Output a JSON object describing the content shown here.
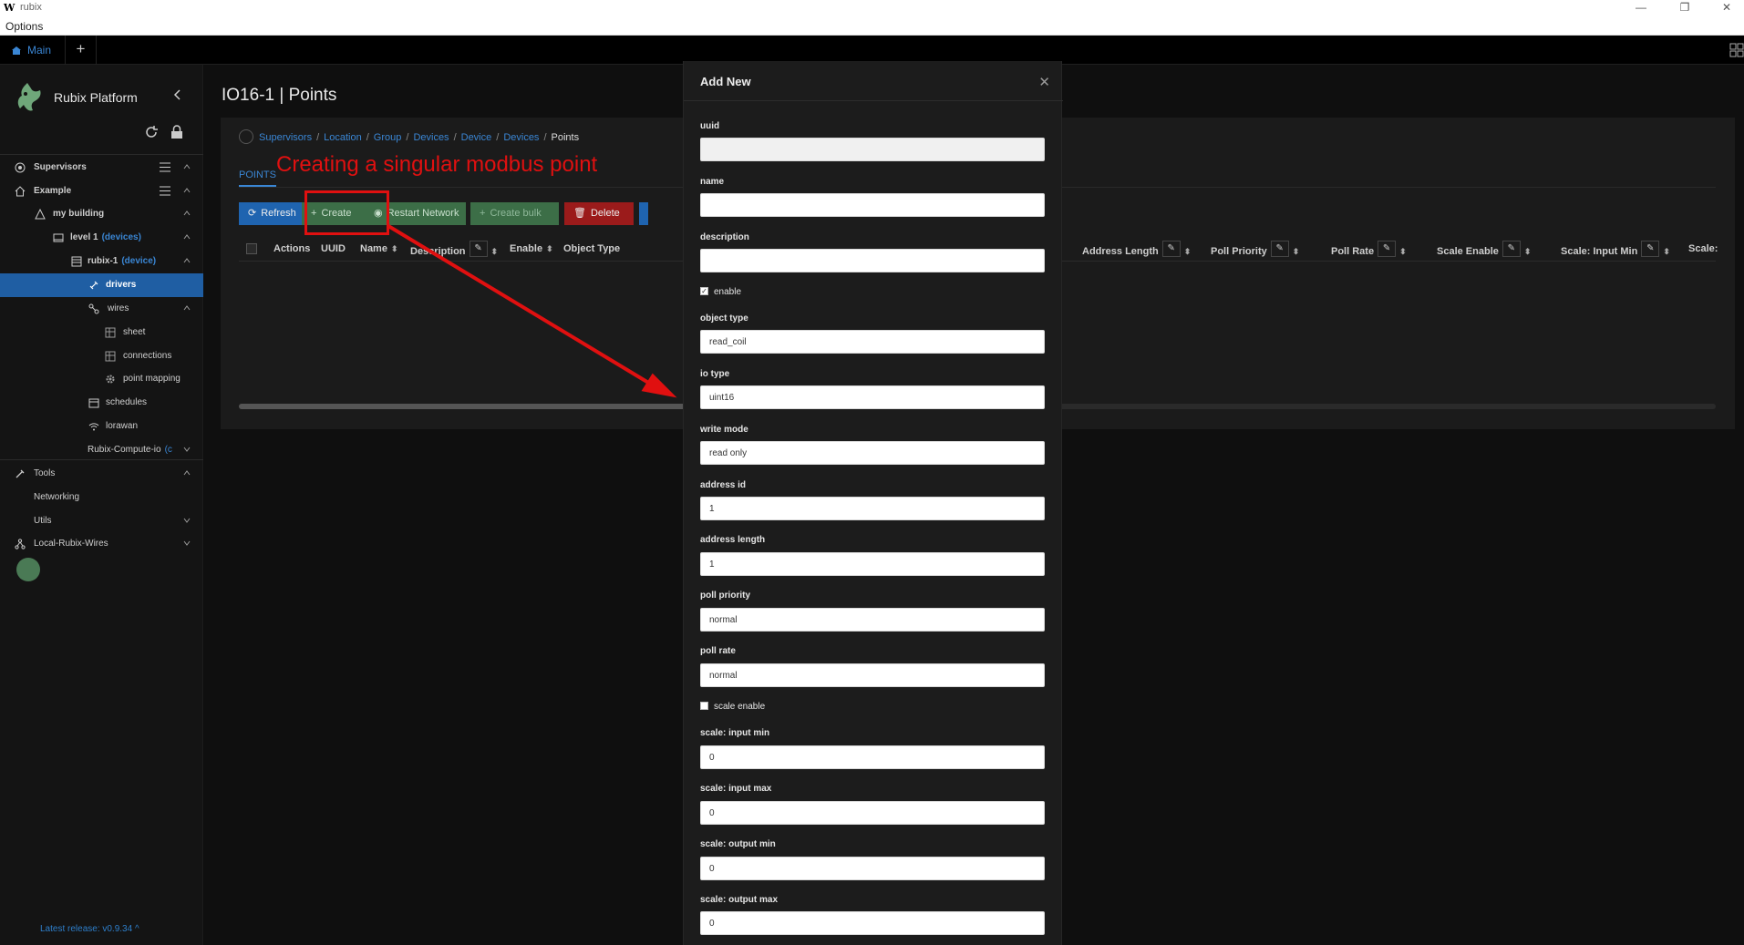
{
  "os": {
    "title": "rubix",
    "menu": "Options",
    "minimize": "—",
    "restore": "❐",
    "close": "✕"
  },
  "tabs": {
    "main_label": "Main",
    "add": "+"
  },
  "sidebar": {
    "brand": "Rubix Platform",
    "items": [
      {
        "label": "Supervisors",
        "tag": ""
      },
      {
        "label": "Example",
        "tag": ""
      },
      {
        "label": "my building",
        "tag": ""
      },
      {
        "label": "level 1",
        "tag": "(devices)"
      },
      {
        "label": "rubix-1",
        "tag": "(device)"
      },
      {
        "label": "drivers",
        "tag": ""
      },
      {
        "label": "wires",
        "tag": ""
      },
      {
        "label": "sheet",
        "tag": ""
      },
      {
        "label": "connections",
        "tag": ""
      },
      {
        "label": "point mapping",
        "tag": ""
      },
      {
        "label": "schedules",
        "tag": ""
      },
      {
        "label": "lorawan",
        "tag": ""
      },
      {
        "label": "Rubix-Compute-io",
        "tag": "(c"
      },
      {
        "label": "Tools",
        "tag": ""
      },
      {
        "label": "Networking",
        "tag": ""
      },
      {
        "label": "Utils",
        "tag": ""
      },
      {
        "label": "Local-Rubix-Wires",
        "tag": ""
      }
    ],
    "release": "Latest release: v0.9.34"
  },
  "main": {
    "title": "IO16-1 | Points",
    "breadcrumb": [
      "Supervisors",
      "Location",
      "Group",
      "Devices",
      "Device",
      "Devices",
      "Points"
    ],
    "tab": "POINTS",
    "buttons": {
      "refresh": "Refresh",
      "create": "Create",
      "restart": "Restart Network",
      "bulk": "Create bulk",
      "delete": "Delete"
    },
    "columns": [
      "Actions",
      "UUID",
      "Name",
      "Description",
      "Enable",
      "Object Type",
      "Address Length",
      "Poll Priority",
      "Poll Rate",
      "Scale Enable",
      "Scale: Input Min",
      "Scale:"
    ]
  },
  "annotation": {
    "text": "Creating a singular modbus point"
  },
  "modal": {
    "title": "Add New",
    "fields": {
      "uuid": {
        "label": "uuid",
        "value": ""
      },
      "name": {
        "label": "name",
        "value": ""
      },
      "description": {
        "label": "description",
        "value": ""
      },
      "enable": {
        "label": "enable",
        "checked": true
      },
      "object_type": {
        "label": "object type",
        "value": "read_coil"
      },
      "io_type": {
        "label": "io type",
        "value": "uint16"
      },
      "write_mode": {
        "label": "write mode",
        "value": "read only"
      },
      "address_id": {
        "label": "address id",
        "value": "1"
      },
      "address_length": {
        "label": "address length",
        "value": "1"
      },
      "poll_priority": {
        "label": "poll priority",
        "value": "normal"
      },
      "poll_rate": {
        "label": "poll rate",
        "value": "normal"
      },
      "scale_enable": {
        "label": "scale enable",
        "checked": false
      },
      "scale_input_min": {
        "label": "scale: input min",
        "value": "0"
      },
      "scale_input_max": {
        "label": "scale: input max",
        "value": "0"
      },
      "scale_output_min": {
        "label": "scale: output min",
        "value": "0"
      },
      "scale_output_max": {
        "label": "scale: output max",
        "value": "0"
      }
    }
  },
  "colors": {
    "accent": "#3a86d4",
    "success": "#3c6e47",
    "danger": "#9b1b1b",
    "annotation": "#e01010"
  }
}
